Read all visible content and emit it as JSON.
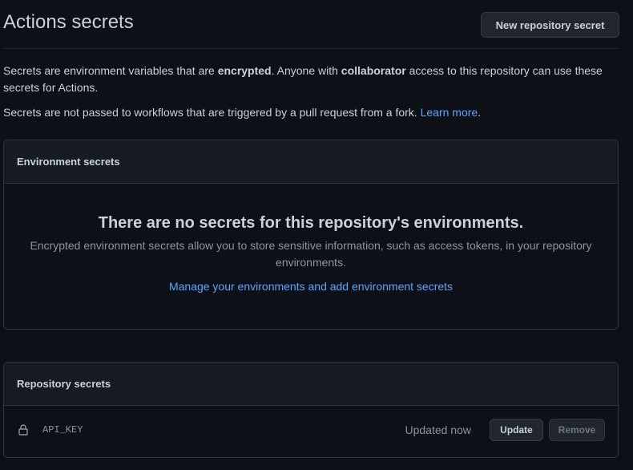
{
  "header": {
    "title": "Actions secrets",
    "new_button_label": "New repository secret"
  },
  "description": {
    "line1_a": "Secrets are environment variables that are ",
    "line1_b": "encrypted",
    "line1_c": ". Anyone with ",
    "line1_d": "collaborator",
    "line1_e": " access to this repository can use these secrets for Actions.",
    "line2_a": "Secrets are not passed to workflows that are triggered by a pull request from a fork. ",
    "line2_link": "Learn more",
    "line2_end": "."
  },
  "environment_secrets": {
    "header": "Environment secrets",
    "blank_title": "There are no secrets for this repository's environments.",
    "blank_text": "Encrypted environment secrets allow you to store sensitive information, such as access tokens, in your repository environments.",
    "manage_link": "Manage your environments and add environment secrets"
  },
  "repository_secrets": {
    "header": "Repository secrets",
    "items": [
      {
        "icon": "lock-icon",
        "name": "API_KEY",
        "updated": "Updated now",
        "update_label": "Update",
        "remove_label": "Remove"
      }
    ]
  },
  "colors": {
    "background": "#0d1117",
    "box_header": "#161b22",
    "border": "#30363d",
    "link": "#58a6ff",
    "text": "#c9d1d9",
    "muted": "#8b949e"
  }
}
